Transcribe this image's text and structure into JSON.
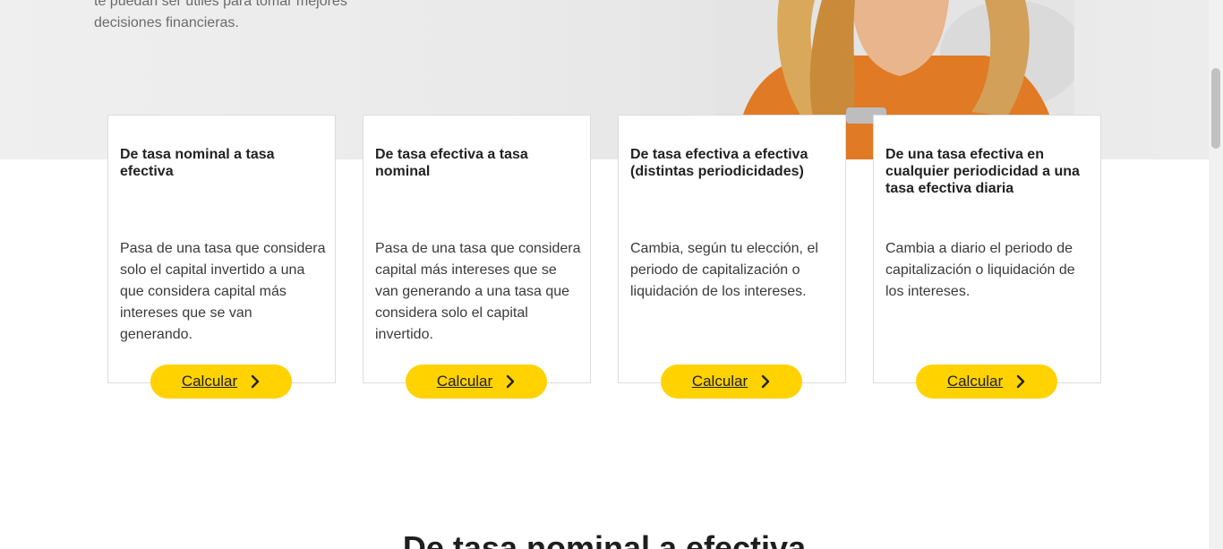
{
  "hero": {
    "text": "te puedan ser útiles para tomar mejores decisiones financieras."
  },
  "cards": [
    {
      "title": "De tasa nominal a tasa efectiva",
      "description": "Pasa de una tasa que considera solo el capital invertido a una que considera capital más intereses que se van generando.",
      "button": "Calcular"
    },
    {
      "title": "De tasa efectiva a tasa nominal",
      "description": "Pasa de una tasa que considera capital más intereses que se van generando a una tasa que considera solo el capital invertido.",
      "button": "Calcular"
    },
    {
      "title": "De tasa efectiva a efectiva (distintas periodicidades)",
      "description": "Cambia, según tu elección, el periodo de capitalización o liquidación de los intereses.",
      "button": "Calcular"
    },
    {
      "title": "De una tasa efectiva en cualquier periodicidad a una tasa efectiva diaria",
      "description": "Cambia a diario el periodo de capitalización o liquidación de los intereses.",
      "button": "Calcular"
    }
  ],
  "section": {
    "title": "De tasa nominal a efectiva"
  },
  "colors": {
    "accent": "#ffd200",
    "text": "#222222"
  },
  "icons": {
    "button": "chevron-right-icon"
  }
}
